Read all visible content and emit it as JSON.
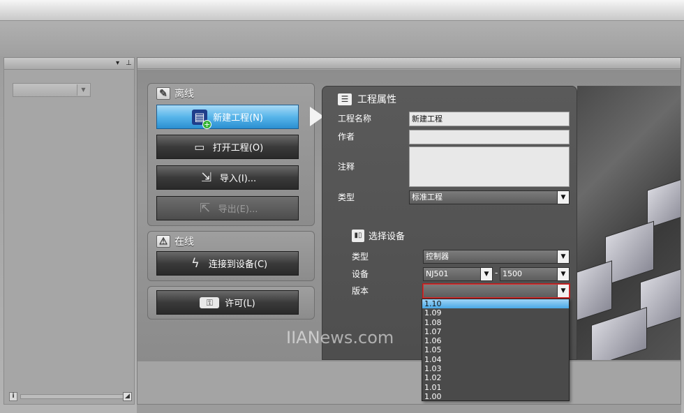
{
  "left_pane": {
    "pin_icon": "pin-icon",
    "dropdown_icon": "chevron-down-icon"
  },
  "offline_group": {
    "title": "离线",
    "buttons": {
      "new_project": "新建工程(N)",
      "open_project": "打开工程(O)",
      "import": "导入(I)...",
      "export": "导出(E)..."
    }
  },
  "online_group": {
    "title": "在线",
    "connect": "连接到设备(C)"
  },
  "license_group": {
    "license": "许可(L)"
  },
  "properties": {
    "title": "工程属性",
    "name_label": "工程名称",
    "name_value": "新建工程",
    "author_label": "作者",
    "author_value": "",
    "comment_label": "注释",
    "comment_value": "",
    "type_label": "类型",
    "type_value": "标准工程",
    "device_section": {
      "title": "选择设备",
      "category_label": "类型",
      "category_value": "控制器",
      "device_label": "设备",
      "device_value": "NJ501",
      "device_sep": "-",
      "device_model": "1500",
      "version_label": "版本",
      "version_value": ""
    }
  },
  "version_options": [
    "1.10",
    "1.09",
    "1.08",
    "1.07",
    "1.06",
    "1.05",
    "1.04",
    "1.03",
    "1.02",
    "1.01",
    "1.00"
  ],
  "selected_version_index": 0,
  "watermark": "IIANews.com",
  "colors": {
    "active_button": "#58b5ea",
    "selection": "#4aa8e6",
    "error_border": "#d23030"
  }
}
